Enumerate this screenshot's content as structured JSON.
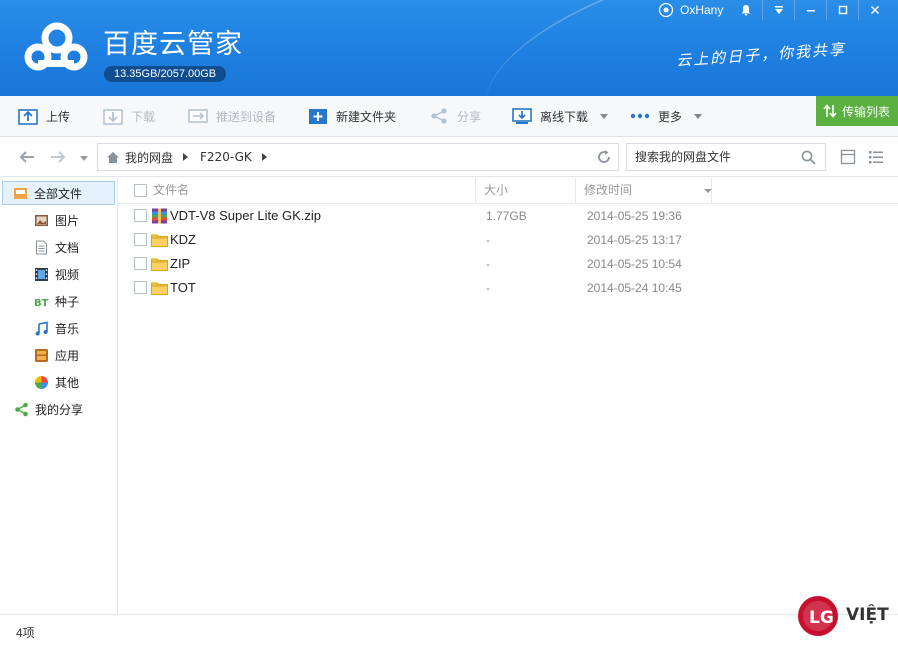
{
  "header": {
    "app_title": "百度云管家",
    "quota": "13.35GB/2057.00GB",
    "slogan": "云上的日子，你我共享",
    "username": "OxHany"
  },
  "toolbar": {
    "upload": "上传",
    "download": "下载",
    "push_to_device": "推送到设备",
    "new_folder": "新建文件夹",
    "share": "分享",
    "offline_download": "离线下载",
    "more": "更多",
    "transfer_list": "传输列表"
  },
  "nav": {
    "breadcrumb": [
      "我的网盘",
      "F220-GK"
    ],
    "search_placeholder": "搜索我的网盘文件"
  },
  "sidebar": {
    "items": [
      {
        "label": "全部文件",
        "icon": "all-files-icon"
      },
      {
        "label": "图片",
        "icon": "image-icon"
      },
      {
        "label": "文档",
        "icon": "document-icon"
      },
      {
        "label": "视频",
        "icon": "video-icon"
      },
      {
        "label": "种子",
        "icon": "bt-icon"
      },
      {
        "label": "音乐",
        "icon": "music-icon"
      },
      {
        "label": "应用",
        "icon": "app-icon"
      },
      {
        "label": "其他",
        "icon": "other-icon"
      },
      {
        "label": "我的分享",
        "icon": "share-icon"
      }
    ]
  },
  "file_list": {
    "columns": [
      "文件名",
      "大小",
      "修改时间"
    ],
    "rows": [
      {
        "name": "VDT-V8 Super Lite GK.zip",
        "size": "1.77GB",
        "modified": "2014-05-25 19:36",
        "type": "zip"
      },
      {
        "name": "KDZ",
        "size": "-",
        "modified": "2014-05-25 13:17",
        "type": "folder"
      },
      {
        "name": "ZIP",
        "size": "-",
        "modified": "2014-05-25 10:54",
        "type": "folder"
      },
      {
        "name": "TOT",
        "size": "-",
        "modified": "2014-05-24 10:45",
        "type": "folder"
      }
    ]
  },
  "status": {
    "count": "4项"
  },
  "watermark": {
    "text": "VIỆT"
  },
  "colors": {
    "header_blue": "#1e7fe0",
    "transfer_green": "#5ab13f",
    "folder_yellow": "#f5c542"
  }
}
